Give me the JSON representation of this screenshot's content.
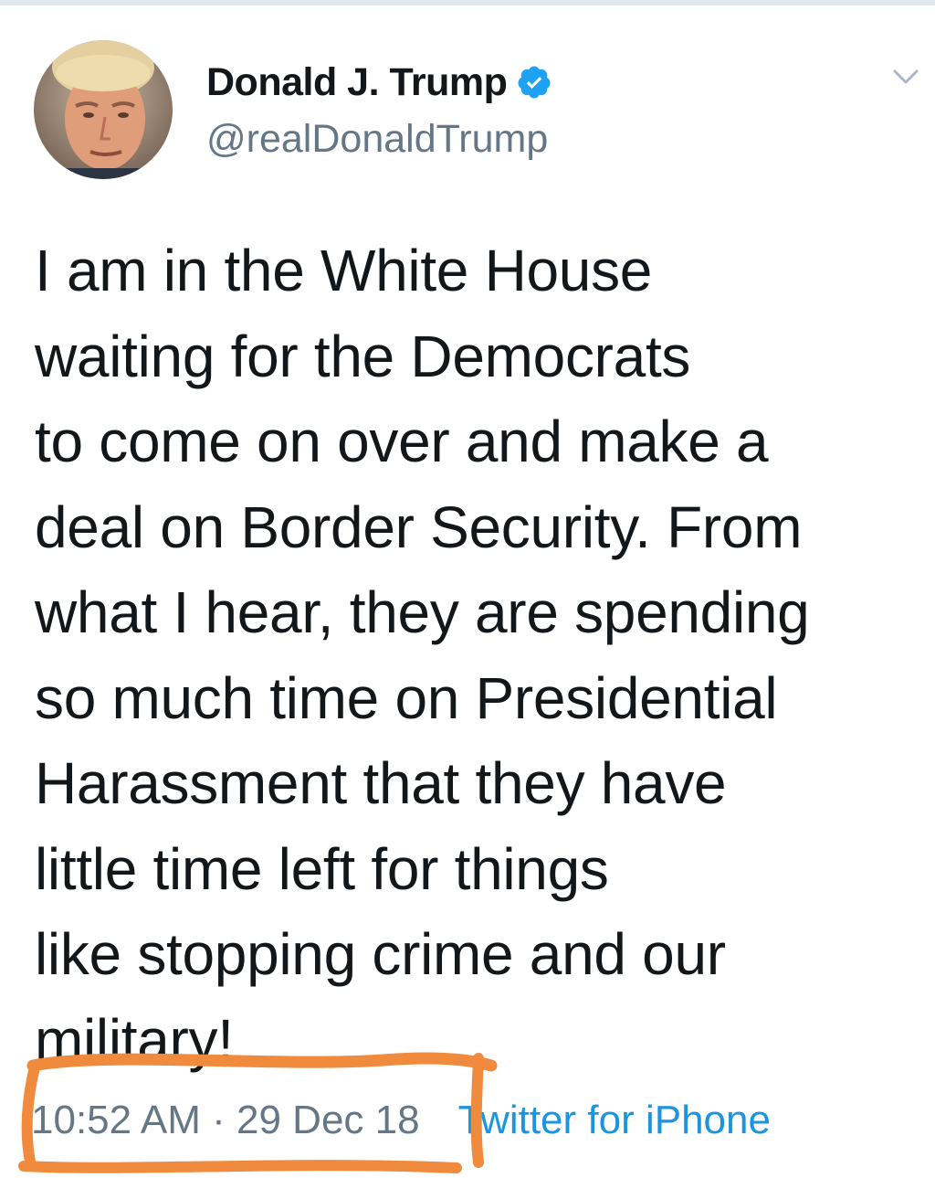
{
  "tweet": {
    "author": {
      "display_name": "Donald J. Trump",
      "handle": "@realDonaldTrump",
      "verified": true
    },
    "text": "I am in the White House\nwaiting for the Democrats\nto come on over and make a\ndeal on Border Security. From\nwhat I hear, they are spending\nso much time on Presidential\nHarassment that they have\nlittle time left for things\nlike stopping crime and our\nmilitary!",
    "timestamp": "10:52 AM · 29 Dec 18",
    "source": "Twitter for iPhone"
  },
  "icons": {
    "verified": "verified-badge-icon",
    "menu": "chevron-down-icon"
  },
  "colors": {
    "text": "#14171a",
    "secondary": "#657786",
    "link": "#1b95e0",
    "verified": "#1da1f2",
    "annotation": "#f08a3c"
  }
}
